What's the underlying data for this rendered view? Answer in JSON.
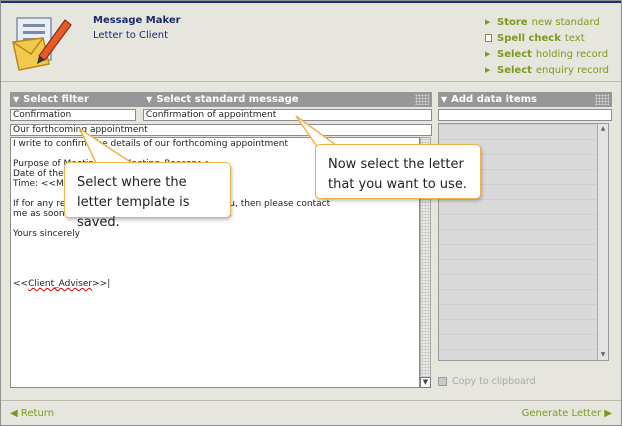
{
  "header": {
    "app_title": "Message Maker",
    "app_subtitle": "Letter to Client",
    "actions": [
      {
        "bold": "Store",
        "rest": "new standard",
        "icon": "play-icon"
      },
      {
        "bold": "Spell check",
        "rest": "text",
        "icon": "checkbox-icon"
      },
      {
        "bold": "Select",
        "rest": "holding record",
        "icon": "play-icon"
      },
      {
        "bold": "Select",
        "rest": "enquiry record",
        "icon": "play-icon"
      }
    ]
  },
  "left_panel": {
    "filter_label": "Select filter",
    "message_label": "Select standard message",
    "filter_value": "Confirmation",
    "message_value": "Confirmation of appointment",
    "subject": "Our forthcoming appointment",
    "letter_lines": [
      "I write to confirm the details of our forthcoming appointment",
      "",
      "Purpose of Meeting:  <<Meeting_Reason>>",
      "Date of the meeting: <<Meeting_Date>>",
      "Time: <<Meeting_Time>>",
      "",
      "If for any reason this time is inconvenient for you, then please contact",
      "me as soon as possible to arrange another time.",
      "",
      "Yours sincerely",
      "",
      "",
      "",
      "",
      "<<Client_Adviser>>|"
    ]
  },
  "right_panel": {
    "add_label": "Add data items",
    "copy_label": "Copy to clipboard"
  },
  "footer": {
    "return_label": "Return",
    "generate_label": "Generate Letter"
  },
  "callouts": {
    "filter_tip": "Select where the letter template is saved.",
    "message_tip": "Now select the letter that you want to use."
  },
  "colors": {
    "accent": "#7a9a1f",
    "title": "#1b2a6b",
    "panel_header": "#979797",
    "callout_border": "#f0b24a"
  }
}
